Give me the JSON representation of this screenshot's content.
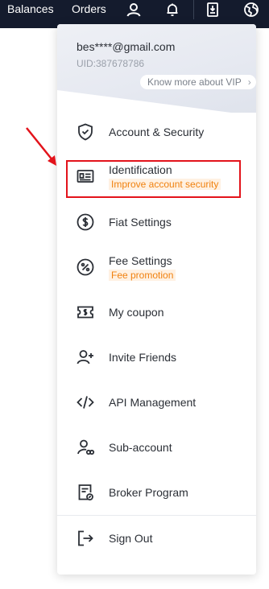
{
  "topbar": {
    "balances_label": "Balances",
    "orders_label": "Orders",
    "icons": [
      "user-icon",
      "bell-icon",
      "download-icon",
      "globe-icon"
    ]
  },
  "account": {
    "email": "bes****@gmail.com",
    "uid": "UID:387678786",
    "vip_link": "Know more about VIP"
  },
  "menu": {
    "items": [
      {
        "label": "Account & Security",
        "icon": "shield-check-icon"
      },
      {
        "label": "Identification",
        "sub": "Improve account security",
        "icon": "id-card-icon"
      },
      {
        "label": "Fiat Settings",
        "icon": "dollar-circle-icon"
      },
      {
        "label": "Fee Settings",
        "sub": "Fee promotion",
        "icon": "percent-circle-icon"
      },
      {
        "label": "My coupon",
        "icon": "coupon-icon"
      },
      {
        "label": "Invite Friends",
        "icon": "add-user-icon"
      },
      {
        "label": "API Management",
        "icon": "code-icon"
      },
      {
        "label": "Sub-account",
        "icon": "sub-account-icon"
      },
      {
        "label": "Broker Program",
        "icon": "broker-document-icon"
      }
    ],
    "sign_out": {
      "label": "Sign Out",
      "icon": "sign-out-icon"
    }
  },
  "colors": {
    "topbar_bg": "#141b2d",
    "accent_orange": "#f0810f",
    "highlight_red": "#e3131b"
  }
}
